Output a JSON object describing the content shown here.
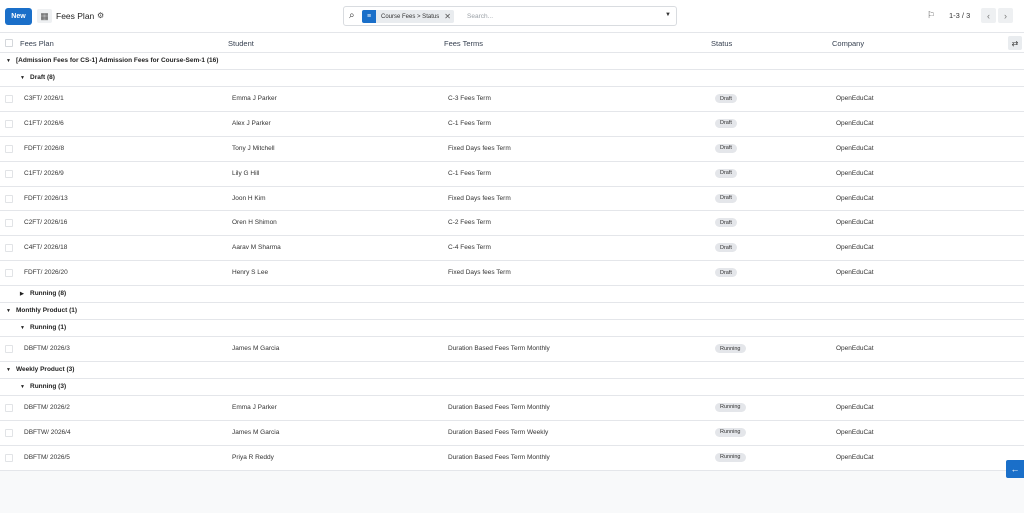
{
  "toolbar": {
    "new_label": "New",
    "title": "Fees Plan",
    "view_icon": "list-view-icon",
    "gear_icon": "gear-icon"
  },
  "search": {
    "facet_label": "Course Fees > Status",
    "placeholder": "Search...",
    "value": ""
  },
  "pager": {
    "value": "1-3 / 3"
  },
  "columns": [
    "Fees Plan",
    "Student",
    "Fees Terms",
    "Status",
    "Company"
  ],
  "groups": [
    {
      "label": "[Admission Fees for CS-1] Admission Fees for Course-Sem-1 (16)",
      "subgroups": [
        {
          "label": "Draft (8)",
          "rows": [
            {
              "plan": "C3FT/ 2026/1",
              "student": "Emma J Parker",
              "terms": "C-3 Fees Term",
              "status": "Draft",
              "company": "OpenEduCat"
            },
            {
              "plan": "C1FT/ 2026/6",
              "student": "Alex J Parker",
              "terms": "C-1 Fees Term",
              "status": "Draft",
              "company": "OpenEduCat"
            },
            {
              "plan": "FDFT/ 2026/8",
              "student": "Tony J Mitchell",
              "terms": "Fixed Days fees Term",
              "status": "Draft",
              "company": "OpenEduCat"
            },
            {
              "plan": "C1FT/ 2026/9",
              "student": "Lily G Hill",
              "terms": "C-1 Fees Term",
              "status": "Draft",
              "company": "OpenEduCat"
            },
            {
              "plan": "FDFT/ 2026/13",
              "student": "Joon H Kim",
              "terms": "Fixed Days fees Term",
              "status": "Draft",
              "company": "OpenEduCat"
            },
            {
              "plan": "C2FT/ 2026/16",
              "student": "Oren H Shimon",
              "terms": "C-2 Fees Term",
              "status": "Draft",
              "company": "OpenEduCat"
            },
            {
              "plan": "C4FT/ 2026/18",
              "student": "Aarav M Sharma",
              "terms": "C-4 Fees Term",
              "status": "Draft",
              "company": "OpenEduCat"
            },
            {
              "plan": "FDFT/ 2026/20",
              "student": "Henry S Lee",
              "terms": "Fixed Days fees Term",
              "status": "Draft",
              "company": "OpenEduCat"
            }
          ]
        },
        {
          "label": "Running (8)",
          "collapsed": true,
          "rows": []
        }
      ]
    },
    {
      "label": "Monthly Product (1)",
      "subgroups": [
        {
          "label": "Running (1)",
          "rows": [
            {
              "plan": "DBFTM/ 2026/3",
              "student": "James M Garcia",
              "terms": "Duration Based Fees Term Monthly",
              "status": "Running",
              "company": "OpenEduCat"
            }
          ]
        }
      ]
    },
    {
      "label": "Weekly Product (3)",
      "subgroups": [
        {
          "label": "Running (3)",
          "rows": [
            {
              "plan": "DBFTM/ 2026/2",
              "student": "Emma J Parker",
              "terms": "Duration Based Fees Term Monthly",
              "status": "Running",
              "company": "OpenEduCat"
            },
            {
              "plan": "DBFTW/ 2026/4",
              "student": "James M Garcia",
              "terms": "Duration Based Fees Term Weekly",
              "status": "Running",
              "company": "OpenEduCat"
            },
            {
              "plan": "DBFTM/ 2026/5",
              "student": "Priya R Reddy",
              "terms": "Duration Based Fees Term Monthly",
              "status": "Running",
              "company": "OpenEduCat"
            }
          ]
        }
      ]
    }
  ],
  "colors": {
    "accent": "#1a6fc9",
    "badge_bg": "#e4e6ea"
  }
}
